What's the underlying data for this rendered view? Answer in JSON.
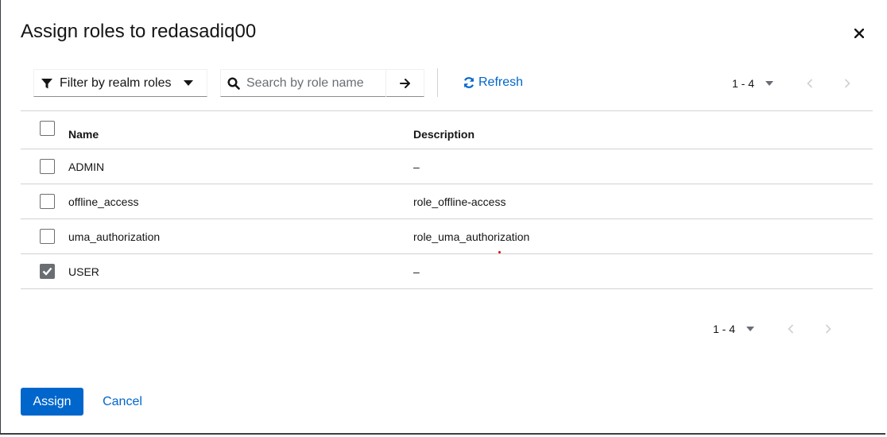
{
  "modal": {
    "title": "Assign roles to redasadiq00",
    "close_icon": "close-icon"
  },
  "toolbar": {
    "filter_label": "Filter by realm roles",
    "filter_icon": "filter-icon",
    "search_placeholder": "Search by role name",
    "search_value": "",
    "refresh_label": "Refresh"
  },
  "pagination_top": {
    "range": "1 - 4"
  },
  "pagination_bottom": {
    "range": "1 - 4"
  },
  "table": {
    "columns": [
      "Name",
      "Description"
    ],
    "rows": [
      {
        "name": "ADMIN",
        "description": "–",
        "checked": false
      },
      {
        "name": "offline_access",
        "description": "role_offline-access",
        "checked": false
      },
      {
        "name": "uma_authorization",
        "description": "role_uma_authorization",
        "checked": false
      },
      {
        "name": "USER",
        "description": "–",
        "checked": true
      }
    ]
  },
  "footer": {
    "assign_label": "Assign",
    "cancel_label": "Cancel"
  },
  "colors": {
    "primary": "#0066cc",
    "border": "#d2d2d2",
    "text": "#151515",
    "checkbox_checked": "#6a6e73"
  }
}
